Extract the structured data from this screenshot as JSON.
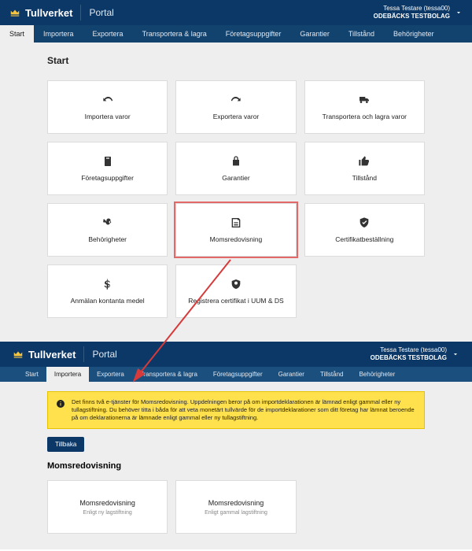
{
  "brand": "Tullverket",
  "portal": "Portal",
  "user": {
    "name": "Tessa Testare (tessa00)",
    "company": "ODEBÄCKS TESTBOLAG"
  },
  "top": {
    "tabs": [
      "Start",
      "Importera",
      "Exportera",
      "Transportera & lagra",
      "Företagsuppgifter",
      "Garantier",
      "Tillstånd",
      "Behörigheter"
    ],
    "active_tab": 0,
    "page_title": "Start",
    "cards": [
      {
        "label": "Importera varor",
        "icon": "redo"
      },
      {
        "label": "Exportera varor",
        "icon": "undo"
      },
      {
        "label": "Transportera och lagra varor",
        "icon": "truck"
      },
      {
        "label": "Företagsuppgifter",
        "icon": "clipboard"
      },
      {
        "label": "Garantier",
        "icon": "lock"
      },
      {
        "label": "Tillstånd",
        "icon": "thumb-up"
      },
      {
        "label": "Behörigheter",
        "icon": "key"
      },
      {
        "label": "Momsredovisning",
        "icon": "note"
      },
      {
        "label": "Certifikatbeställning",
        "icon": "shield"
      },
      {
        "label": "Anmälan kontanta medel",
        "icon": "dollar"
      },
      {
        "label": "Registrera certifikat i UUM & DS",
        "icon": "cert"
      }
    ],
    "highlighted_card_index": 7
  },
  "bottom": {
    "tabs": [
      "Start",
      "Importera",
      "Exportera",
      "Transportera & lagra",
      "Företagsuppgifter",
      "Garantier",
      "Tillstånd",
      "Behörigheter"
    ],
    "active_tab": 1,
    "alert": "Det finns två e-tjänster för Momsredovisning. Uppdelningen beror på om importdeklarationen är lämnad enligt gammal eller ny tullagstiftning. Du behöver titta i båda för att veta monetärt tullvärde för de importdeklarationer som ditt företag har lämnat beroende på om deklarationerna är lämnade enligt gammal eller ny tullagstiftning.",
    "back_label": "Tillbaka",
    "section_title": "Momsredovisning",
    "cards": [
      {
        "title": "Momsredovisning",
        "sub": "Enligt ny lagstiftning"
      },
      {
        "title": "Momsredovisning",
        "sub": "Enligt gammal lagstiftning"
      }
    ]
  }
}
